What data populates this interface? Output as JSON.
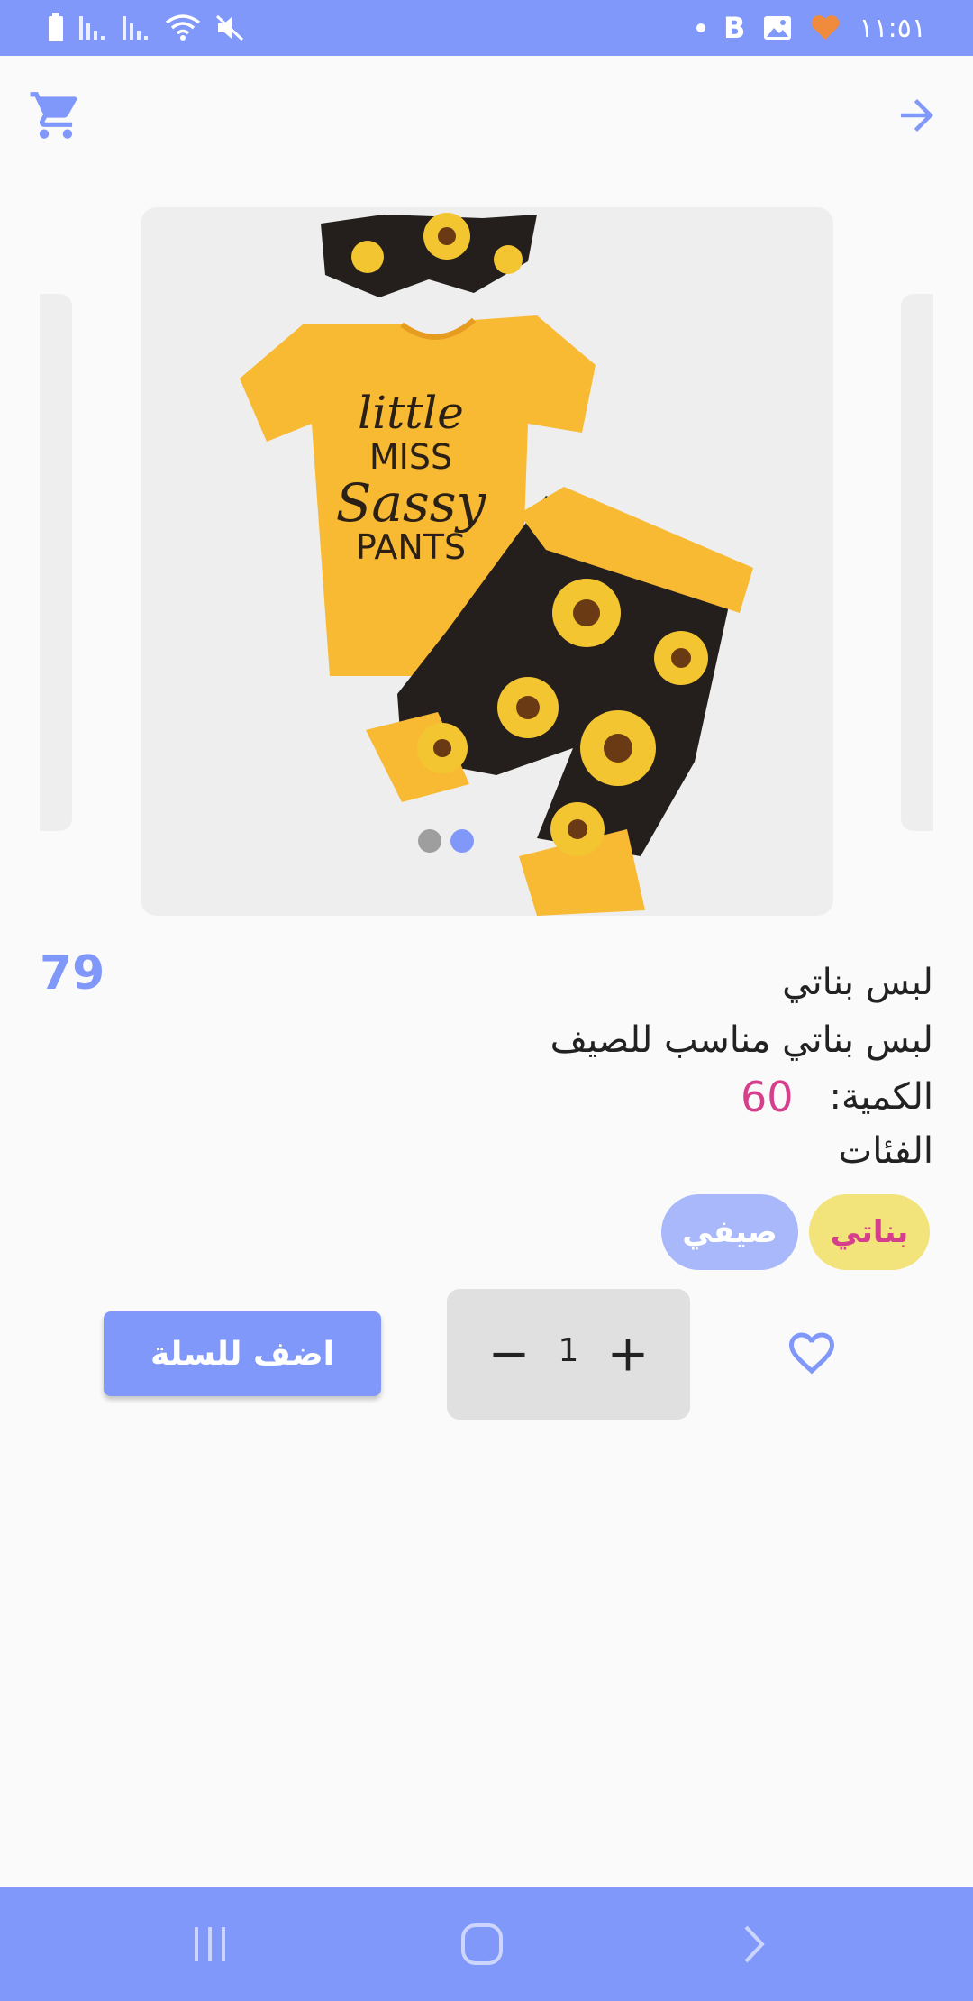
{
  "status_bar": {
    "time": "١١:٥١",
    "icons": [
      "battery-icon",
      "signal-icon",
      "signal-icon",
      "wifi-icon",
      "mute-icon",
      "dot-icon",
      "b-icon",
      "gallery-icon",
      "heart-badge-icon"
    ],
    "b_label": "B"
  },
  "app_bar": {
    "cart_icon": "cart-icon",
    "back_icon": "arrow-right-icon"
  },
  "carousel": {
    "image_text": [
      "little",
      "MISS",
      "Sassy",
      "PANTS"
    ],
    "active_index": 1,
    "count": 2
  },
  "product": {
    "price": "79",
    "title": "لبس بناتي",
    "description": "لبس بناتي مناسب للصيف",
    "quantity_label": "الكمية:",
    "quantity_value": "60",
    "categories_label": "الفئات",
    "categories": [
      "بناتي",
      "صيفي"
    ]
  },
  "actions": {
    "add_to_cart_label": "اضف للسلة",
    "stepper_value": "1",
    "favorite_icon": "heart-outline-icon"
  },
  "colors": {
    "primary": "#8098f9",
    "accent_pink": "#d63f8c",
    "chip_yellow": "#f2e37a",
    "chip_blue": "#a8b8fb"
  },
  "nav_bar": {
    "icons": [
      "recents-icon",
      "home-icon",
      "back-icon"
    ]
  }
}
